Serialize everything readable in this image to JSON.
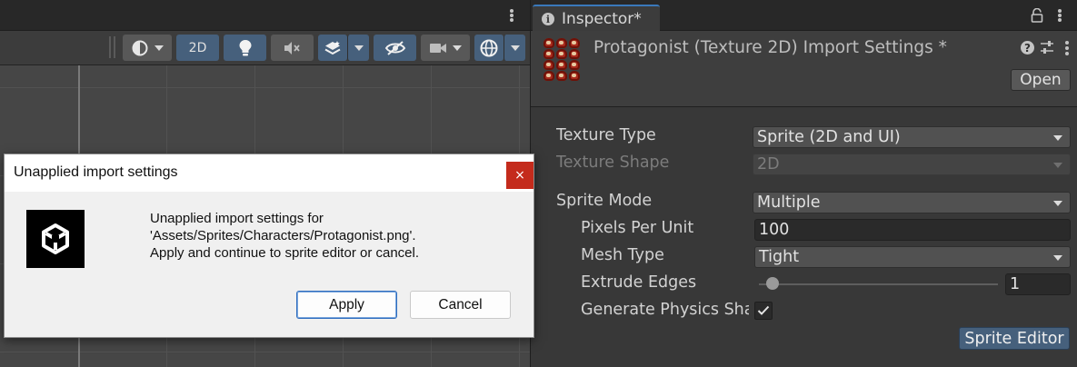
{
  "scene": {
    "toolbar": {
      "shading_icon": "shading-mode-icon",
      "btn_2d_label": "2D",
      "lighting_icon": "lightbulb-icon",
      "audio_icon": "audio-mute-icon",
      "effects_icon": "effects-layers-icon",
      "visibility_icon": "scene-visibility-icon",
      "camera_icon": "camera-icon",
      "gizmos_icon": "gizmos-globe-icon"
    }
  },
  "inspector": {
    "tab_label": "Inspector*",
    "title": "Protagonist (Texture 2D) Import Settings *",
    "open_label": "Open",
    "fields": {
      "texture_type_label": "Texture Type",
      "texture_type_value": "Sprite (2D and UI)",
      "texture_shape_label": "Texture Shape",
      "texture_shape_value": "2D",
      "sprite_mode_label": "Sprite Mode",
      "sprite_mode_value": "Multiple",
      "ppu_label": "Pixels Per Unit",
      "ppu_value": "100",
      "mesh_type_label": "Mesh Type",
      "mesh_type_value": "Tight",
      "extrude_label": "Extrude Edges",
      "extrude_value": "1",
      "extrude_slider_fraction": 0.03,
      "physics_label": "Generate Physics Shape",
      "physics_checked": true
    },
    "sprite_editor_label": "Sprite Editor"
  },
  "dialog": {
    "title": "Unapplied import settings",
    "close_glyph": "×",
    "message_lines": [
      "Unapplied import settings for",
      "'Assets/Sprites/Characters/Protagonist.png'.",
      "Apply and continue to sprite editor or cancel."
    ],
    "apply_label": "Apply",
    "cancel_label": "Cancel"
  },
  "colors": {
    "accent_blue": "#46607c",
    "tab_highlight": "#3a79bb",
    "close_red": "#c42b1c"
  }
}
